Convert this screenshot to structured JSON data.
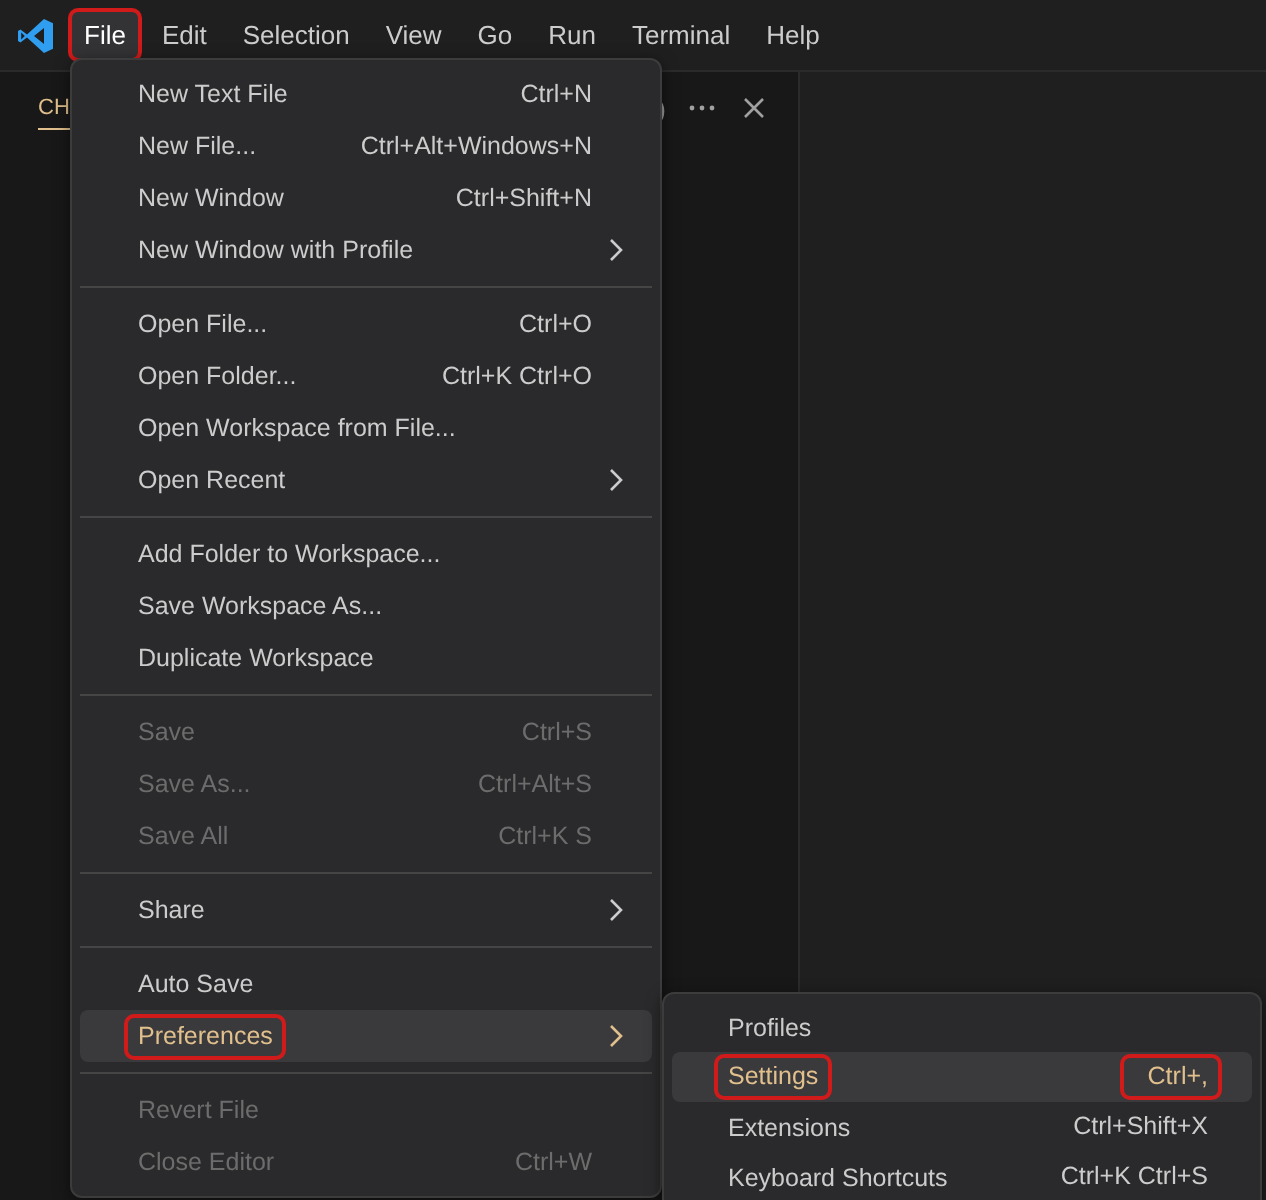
{
  "menubar": {
    "items": [
      {
        "label": "File",
        "selected": true,
        "annotated": true
      },
      {
        "label": "Edit",
        "selected": false,
        "annotated": false
      },
      {
        "label": "Selection",
        "selected": false,
        "annotated": false
      },
      {
        "label": "View",
        "selected": false,
        "annotated": false
      },
      {
        "label": "Go",
        "selected": false,
        "annotated": false
      },
      {
        "label": "Run",
        "selected": false,
        "annotated": false
      },
      {
        "label": "Terminal",
        "selected": false,
        "annotated": false
      },
      {
        "label": "Help",
        "selected": false,
        "annotated": false
      }
    ]
  },
  "side_panel": {
    "tab_label": "CH",
    "tab_fragment": ")"
  },
  "file_menu": {
    "items": [
      {
        "kind": "item",
        "label": "New Text File",
        "shortcut": "Ctrl+N",
        "submenu": false,
        "disabled": false,
        "selected": false,
        "annotated": false
      },
      {
        "kind": "item",
        "label": "New File...",
        "shortcut": "Ctrl+Alt+Windows+N",
        "submenu": false,
        "disabled": false,
        "selected": false,
        "annotated": false
      },
      {
        "kind": "item",
        "label": "New Window",
        "shortcut": "Ctrl+Shift+N",
        "submenu": false,
        "disabled": false,
        "selected": false,
        "annotated": false
      },
      {
        "kind": "item",
        "label": "New Window with Profile",
        "submenu": true,
        "disabled": false,
        "selected": false,
        "annotated": false
      },
      {
        "kind": "separator"
      },
      {
        "kind": "item",
        "label": "Open File...",
        "shortcut": "Ctrl+O",
        "submenu": false,
        "disabled": false,
        "selected": false,
        "annotated": false
      },
      {
        "kind": "item",
        "label": "Open Folder...",
        "shortcut": "Ctrl+K Ctrl+O",
        "submenu": false,
        "disabled": false,
        "selected": false,
        "annotated": false
      },
      {
        "kind": "item",
        "label": "Open Workspace from File...",
        "submenu": false,
        "disabled": false,
        "selected": false,
        "annotated": false
      },
      {
        "kind": "item",
        "label": "Open Recent",
        "submenu": true,
        "disabled": false,
        "selected": false,
        "annotated": false
      },
      {
        "kind": "separator"
      },
      {
        "kind": "item",
        "label": "Add Folder to Workspace...",
        "submenu": false,
        "disabled": false,
        "selected": false,
        "annotated": false
      },
      {
        "kind": "item",
        "label": "Save Workspace As...",
        "submenu": false,
        "disabled": false,
        "selected": false,
        "annotated": false
      },
      {
        "kind": "item",
        "label": "Duplicate Workspace",
        "submenu": false,
        "disabled": false,
        "selected": false,
        "annotated": false
      },
      {
        "kind": "separator"
      },
      {
        "kind": "item",
        "label": "Save",
        "shortcut": "Ctrl+S",
        "submenu": false,
        "disabled": true,
        "selected": false,
        "annotated": false
      },
      {
        "kind": "item",
        "label": "Save As...",
        "shortcut": "Ctrl+Alt+S",
        "submenu": false,
        "disabled": true,
        "selected": false,
        "annotated": false
      },
      {
        "kind": "item",
        "label": "Save All",
        "shortcut": "Ctrl+K S",
        "submenu": false,
        "disabled": true,
        "selected": false,
        "annotated": false
      },
      {
        "kind": "separator"
      },
      {
        "kind": "item",
        "label": "Share",
        "submenu": true,
        "disabled": false,
        "selected": false,
        "annotated": false
      },
      {
        "kind": "separator"
      },
      {
        "kind": "item",
        "label": "Auto Save",
        "submenu": false,
        "disabled": false,
        "selected": false,
        "annotated": false
      },
      {
        "kind": "item",
        "label": "Preferences",
        "submenu": true,
        "disabled": false,
        "selected": true,
        "annotated": true
      },
      {
        "kind": "separator"
      },
      {
        "kind": "item",
        "label": "Revert File",
        "submenu": false,
        "disabled": true,
        "selected": false,
        "annotated": false
      },
      {
        "kind": "item",
        "label": "Close Editor",
        "shortcut": "Ctrl+W",
        "submenu": false,
        "disabled": true,
        "selected": false,
        "annotated": false
      }
    ]
  },
  "preferences_menu": {
    "items": [
      {
        "kind": "item",
        "label": "Profiles",
        "submenu": false,
        "disabled": false,
        "selected": false,
        "annotated": false
      },
      {
        "kind": "item",
        "label": "Settings",
        "shortcut": "Ctrl+,",
        "submenu": false,
        "disabled": false,
        "selected": true,
        "annotated": true
      },
      {
        "kind": "item",
        "label": "Extensions",
        "shortcut": "Ctrl+Shift+X",
        "submenu": false,
        "disabled": false,
        "selected": false,
        "annotated": false
      },
      {
        "kind": "item",
        "label": "Keyboard Shortcuts",
        "shortcut": "Ctrl+K Ctrl+S",
        "submenu": false,
        "disabled": false,
        "selected": false,
        "annotated": false
      }
    ]
  }
}
